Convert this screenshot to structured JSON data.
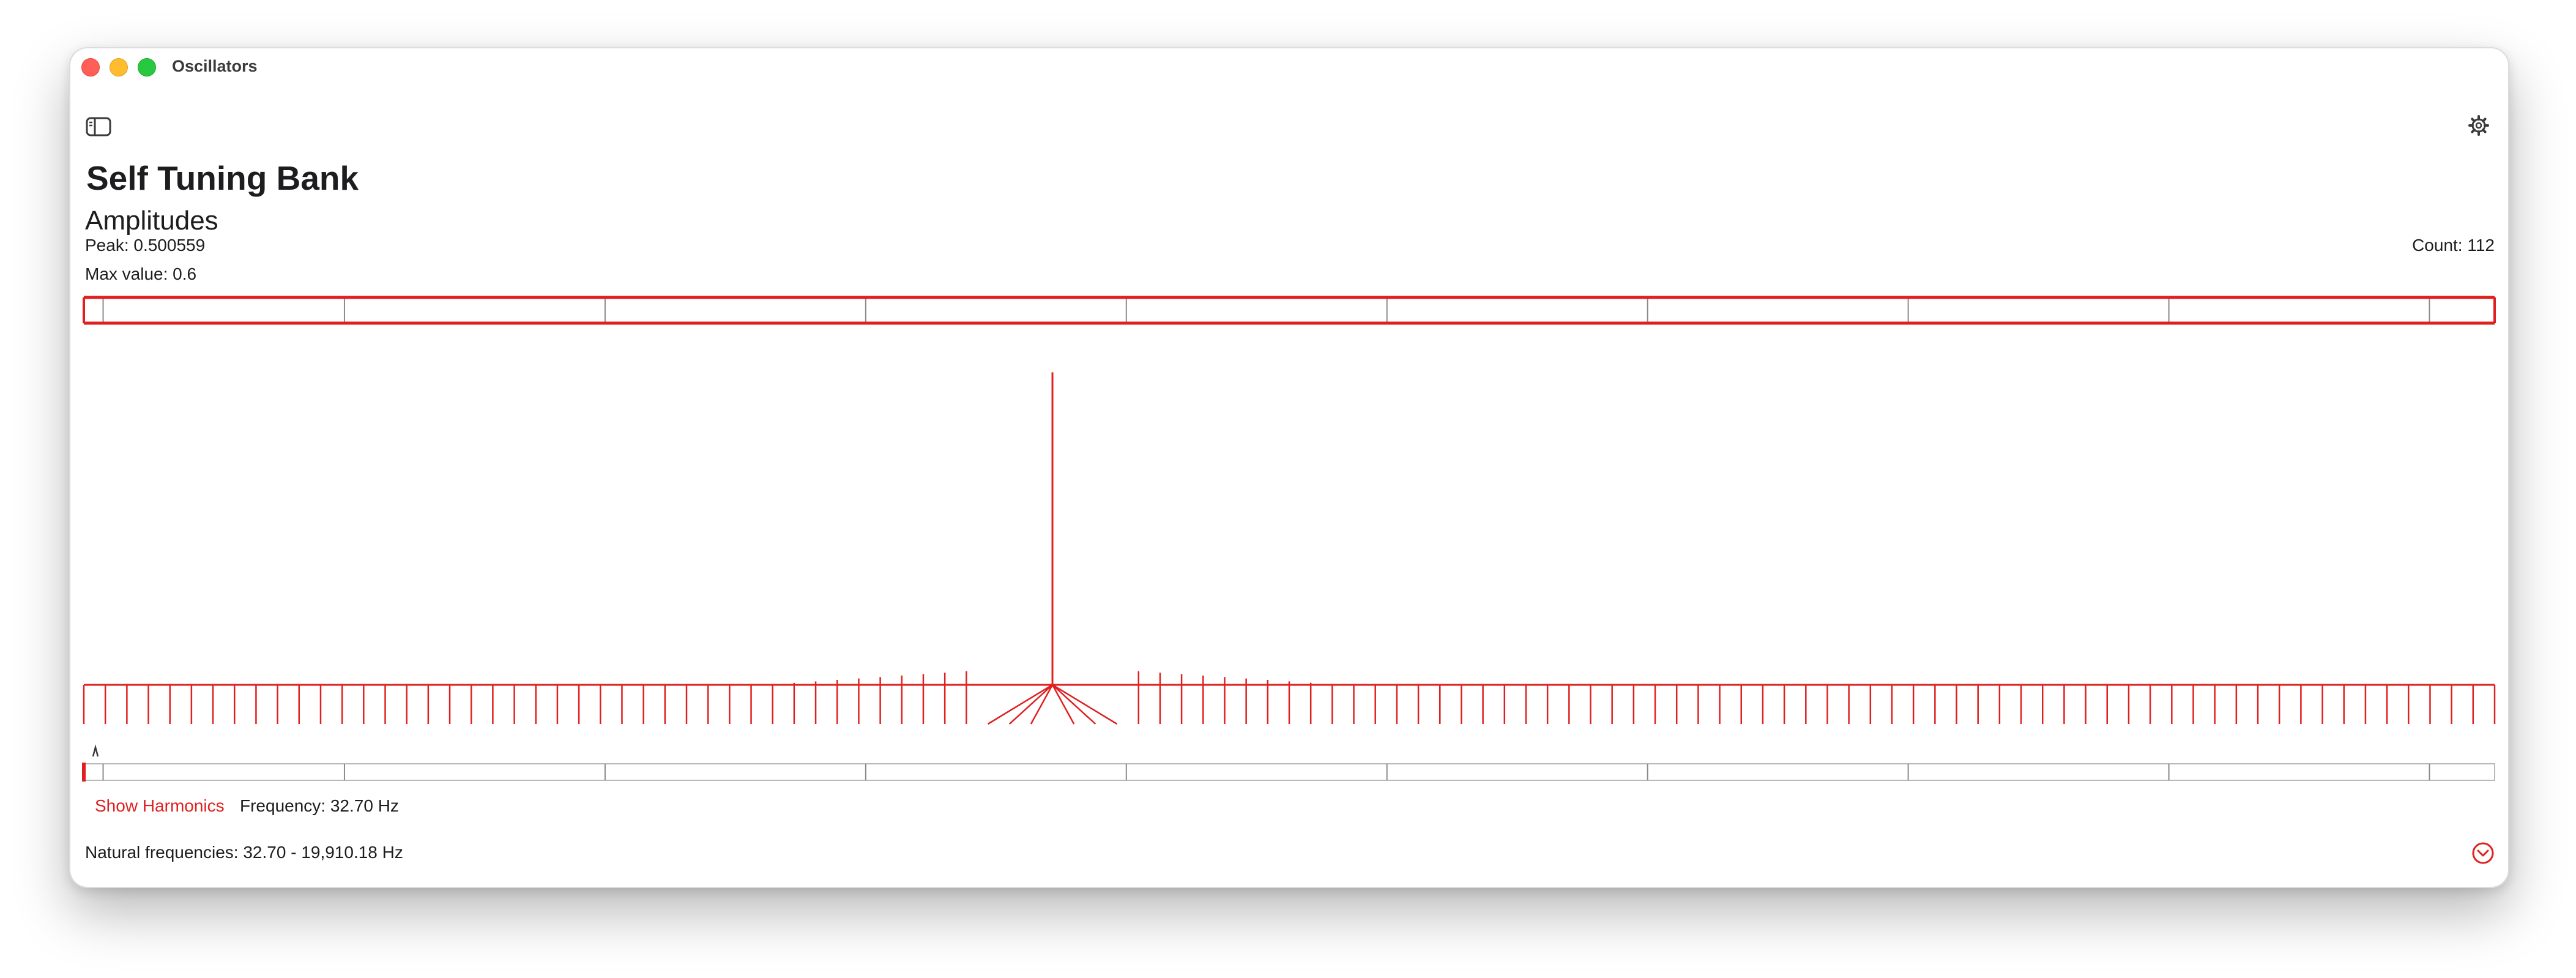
{
  "window": {
    "title": "Oscillators"
  },
  "icons": {
    "sidebar": "sidebar-toggle-icon",
    "settings": "gear-icon",
    "expand": "chevron-down-circle-icon"
  },
  "colors": {
    "accent": "#e02020"
  },
  "header": {
    "title": "Self Tuning Bank"
  },
  "amplitudes": {
    "title": "Amplitudes",
    "peak_label": "Peak: 0.500559",
    "max_label": "Max value: 0.6",
    "count_label": "Count: 112"
  },
  "footer": {
    "show_harmonics_label": "Show Harmonics",
    "frequency_label": "Frequency: 32.70 Hz",
    "natural_label": "Natural frequencies: 32.70 - 19,910.18 Hz"
  },
  "chart_data": {
    "type": "bar",
    "title": "Amplitudes",
    "count": 112,
    "peak": 0.500559,
    "max_value": 0.6,
    "frequency_range_hz": [
      32.7,
      19910.18
    ],
    "selected_frequency_hz": 32.7,
    "peak_index": 45
  }
}
